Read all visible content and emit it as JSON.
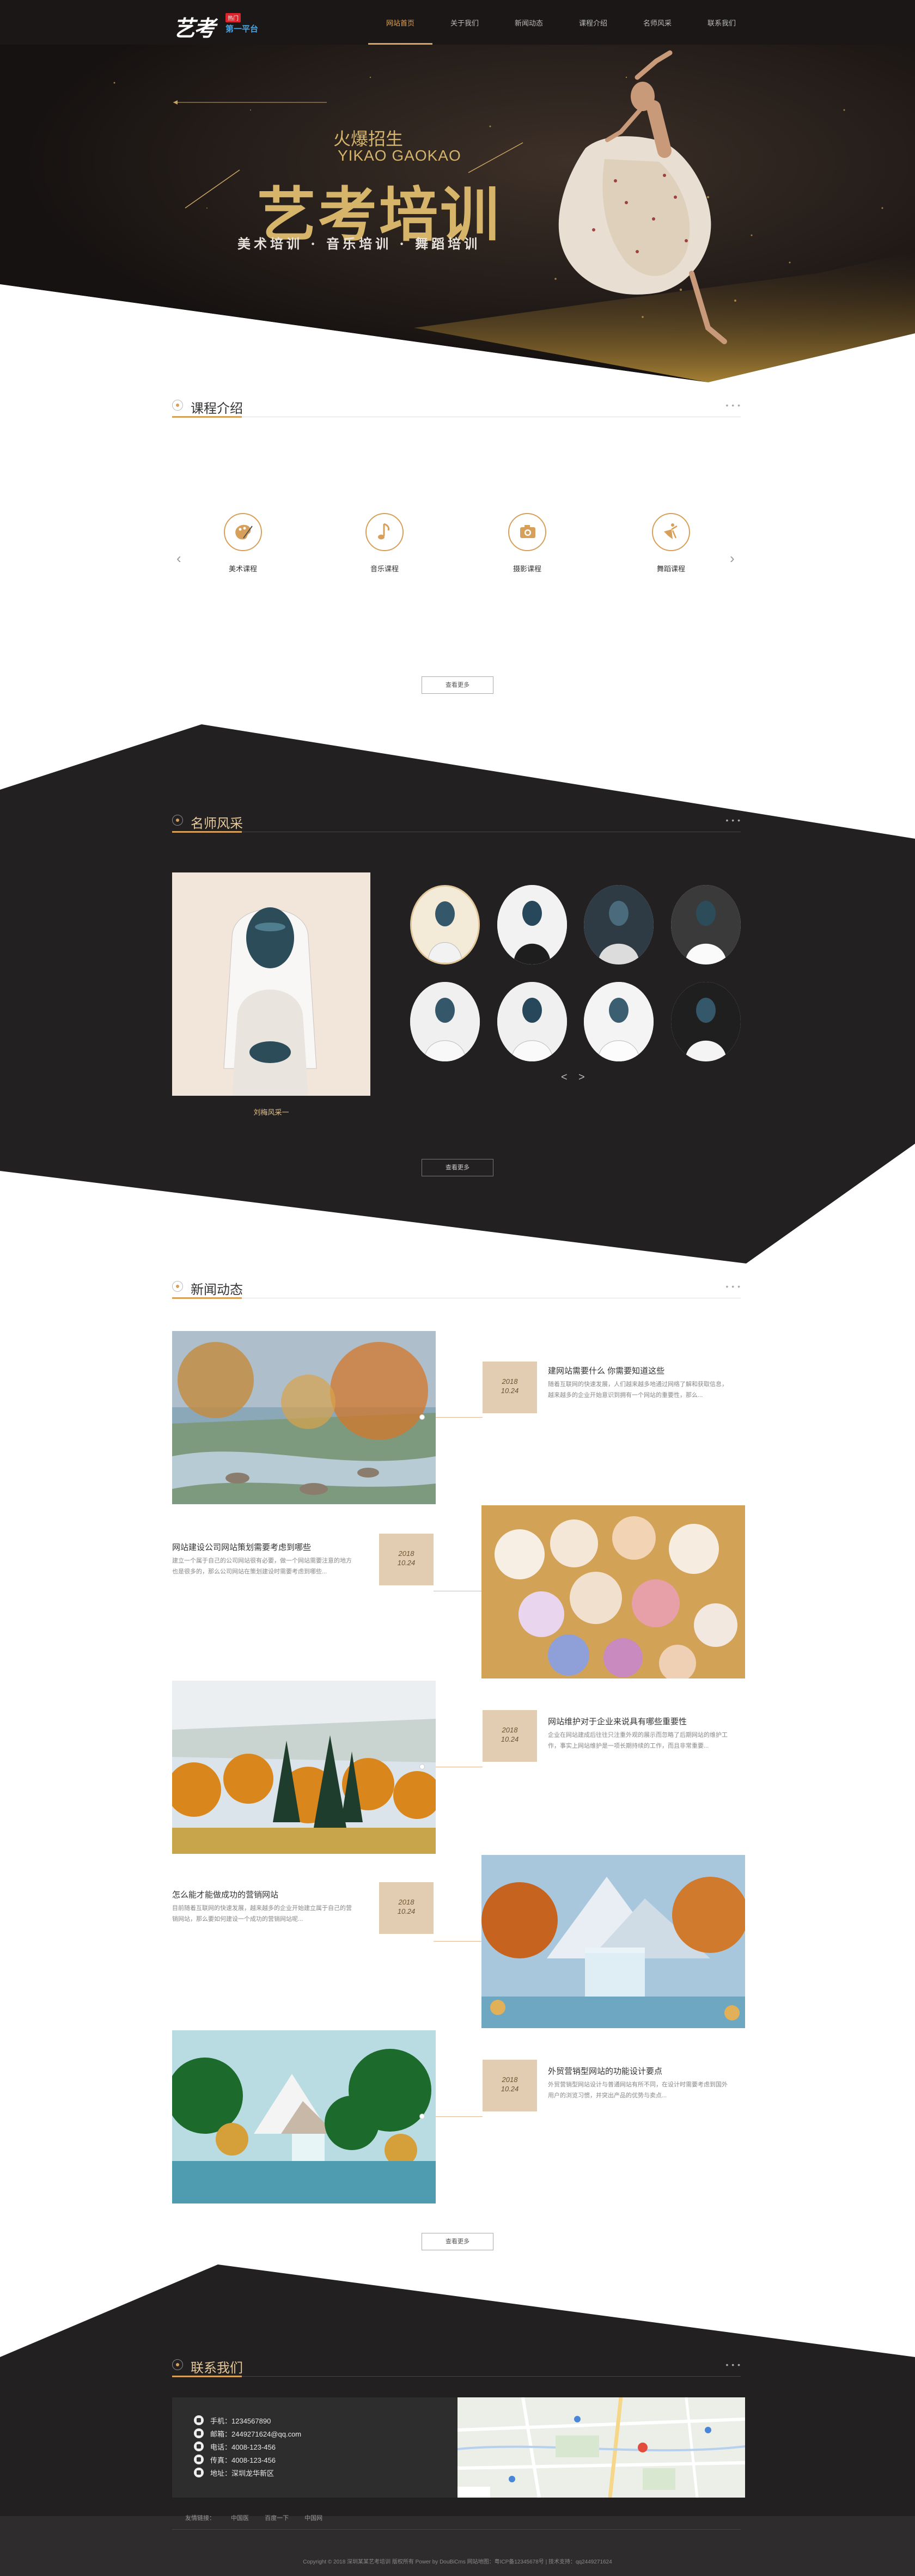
{
  "header": {
    "logo_text": "艺考",
    "logo_badge": "热门",
    "logo_sub": "第一平台",
    "nav": [
      "网站首页",
      "关于我们",
      "新闻动态",
      "课程介绍",
      "名师风采",
      "联系我们"
    ],
    "active_index": 0
  },
  "hero": {
    "tag": "火爆招生",
    "pinyin": "YIKAO GAOKAO",
    "title": "艺考培训",
    "subtitle": "美术培训 · 音乐培训 · 舞蹈培训"
  },
  "courses": {
    "title": "课程介绍",
    "dots": "• • •",
    "items": [
      {
        "label": "美术课程",
        "icon": "palette-icon"
      },
      {
        "label": "音乐课程",
        "icon": "music-note-icon"
      },
      {
        "label": "摄影课程",
        "icon": "camera-icon"
      },
      {
        "label": "舞蹈课程",
        "icon": "dancer-icon"
      }
    ],
    "prev": "‹",
    "next": "›",
    "more": "查看更多"
  },
  "teachers": {
    "title": "名师风采",
    "dots": "• • •",
    "featured_caption": "刘梅风采一",
    "prev": "<",
    "next": ">",
    "more": "查看更多"
  },
  "news": {
    "title": "新闻动态",
    "dots": "• • •",
    "items": [
      {
        "year": "2018",
        "date": "10.24",
        "title": "建网站需要什么 你需要知道这些",
        "desc": "随着互联网的快速发展，人们越来越多地通过网络了解和获取信息，越来越多的企业开始意识到拥有一个网站的重要性，那么..."
      },
      {
        "year": "2018",
        "date": "10.24",
        "title": "网站建设公司网站策划需要考虑到哪些",
        "desc": "建立一个属于自己的公司网站很有必要，做一个网站需要注意的地方也是很多的，那么公司网站在策划建设时需要考虑到哪些..."
      },
      {
        "year": "2018",
        "date": "10.24",
        "title": "网站维护对于企业来说具有哪些重要性",
        "desc": "企业在网站建成后往往只注重外观的展示而忽略了后期网站的维护工作，事实上网站维护是一项长期持续的工作，而且非常重要..."
      },
      {
        "year": "2018",
        "date": "10.24",
        "title": "怎么能才能做成功的营销网站",
        "desc": "目前随着互联网的快速发展，越来越多的企业开始建立属于自己的营销网站，那么要如何建设一个成功的营销网站呢..."
      },
      {
        "year": "2018",
        "date": "10.24",
        "title": "外贸营销型网站的功能设计要点",
        "desc": "外贸营销型网站设计与普通网站有所不同，在设计时需要考虑到国外用户的浏览习惯，并突出产品的优势与卖点..."
      }
    ],
    "more": "查看更多"
  },
  "contact": {
    "title": "联系我们",
    "dots": "• • •",
    "rows": [
      {
        "icon": "mobile-icon",
        "text": "手机：1234567890"
      },
      {
        "icon": "email-icon",
        "text": "邮箱：2449271624@qq.com"
      },
      {
        "icon": "phone-icon",
        "text": "电话：4008-123-456"
      },
      {
        "icon": "fax-icon",
        "text": "传真：4008-123-456"
      },
      {
        "icon": "location-icon",
        "text": "地址：深圳龙华新区"
      }
    ]
  },
  "footer": {
    "links": [
      "友情链接：",
      "中国医",
      "百度一下",
      "中国网"
    ],
    "copyright": "Copyright © 2018 深圳某某艺考培训 版权所有 Power by DouBiCms 网站地图：粤ICP备12345678号 | 技术支持：qq2449271624"
  },
  "colors": {
    "accent": "#d7a05a",
    "dark_bg": "#222020",
    "date_bg": "#e2cdb3"
  }
}
